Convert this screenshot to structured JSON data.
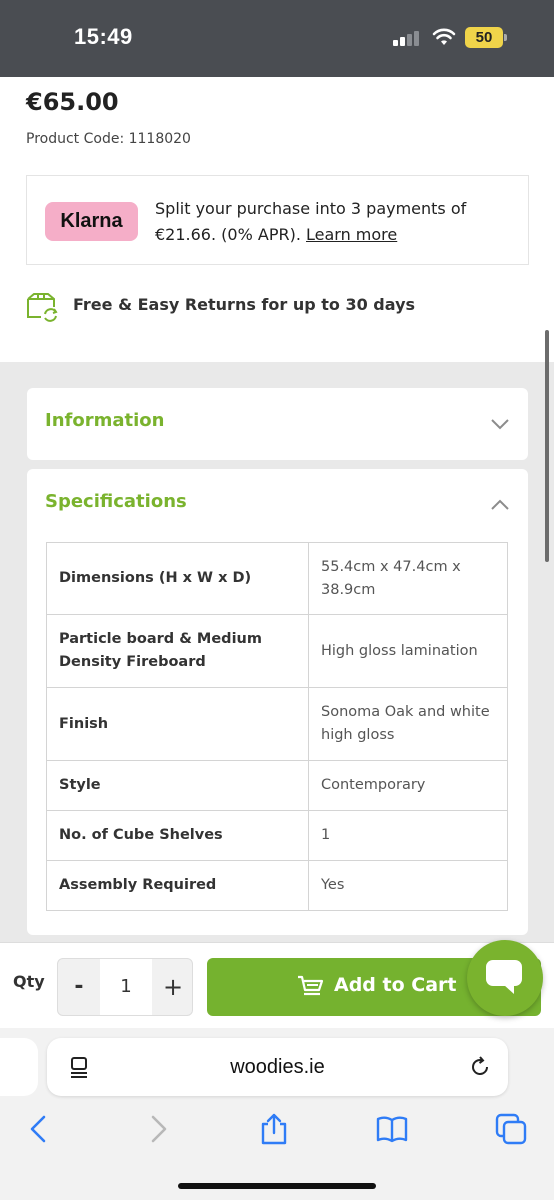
{
  "status": {
    "time": "15:49",
    "battery": "50"
  },
  "product": {
    "price": "€65.00",
    "code_label": "Product Code: 1118020"
  },
  "klarna": {
    "badge": "Klarna",
    "text": "Split your purchase into 3 payments of €21.66. (0% APR).",
    "link": "Learn more"
  },
  "returns": {
    "text": "Free & Easy Returns for up to 30 days"
  },
  "accordions": {
    "information": {
      "title": "Information",
      "expanded": false
    },
    "specifications": {
      "title": "Specifications",
      "expanded": true
    }
  },
  "specs": [
    {
      "label": "Dimensions (H x W x D)",
      "value": "55.4cm x 47.4cm x 38.9cm"
    },
    {
      "label": "Particle board & Medium Density Fireboard",
      "value": "High gloss lamination"
    },
    {
      "label": "Finish",
      "value": "Sonoma Oak and white high gloss"
    },
    {
      "label": "Style",
      "value": "Contemporary"
    },
    {
      "label": "No. of Cube Shelves",
      "value": "1"
    },
    {
      "label": "Assembly Required",
      "value": "Yes"
    }
  ],
  "purchase": {
    "qty_label": "Qty",
    "minus": "-",
    "qty": "1",
    "plus": "+",
    "add_to_cart": "Add to Cart"
  },
  "browser": {
    "url": "woodies.ie"
  },
  "colors": {
    "brand_green": "#7ab32e",
    "klarna_pink": "#f5aec8",
    "status_bar": "#4a4d52"
  },
  "icons": [
    "signal-icon",
    "wifi-icon",
    "battery-icon",
    "returns-icon",
    "chevron-down-icon",
    "chevron-up-icon",
    "cart-icon",
    "chat-icon",
    "page-menu-icon",
    "reload-icon",
    "back-icon",
    "forward-icon",
    "share-icon",
    "bookmarks-icon",
    "tabs-icon"
  ]
}
